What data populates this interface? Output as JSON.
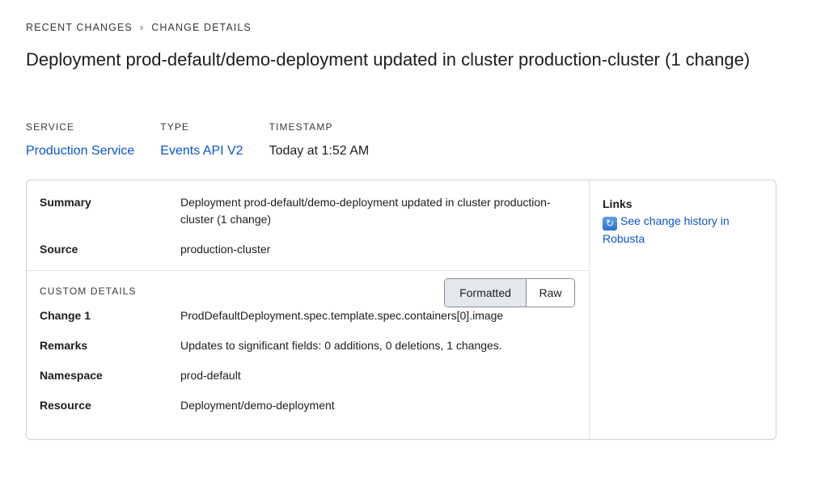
{
  "breadcrumb": {
    "parent": "RECENT CHANGES",
    "separator": "›",
    "current": "CHANGE DETAILS"
  },
  "title": "Deployment prod-default/demo-deployment updated in cluster production-cluster (1 change)",
  "meta": {
    "service": {
      "label": "SERVICE",
      "value": "Production Service"
    },
    "type": {
      "label": "TYPE",
      "value": "Events API V2"
    },
    "timestamp": {
      "label": "TIMESTAMP",
      "value": "Today at 1:52 AM"
    }
  },
  "details": {
    "summary": {
      "label": "Summary",
      "value": "Deployment prod-default/demo-deployment updated in cluster production-cluster (1 change)"
    },
    "source": {
      "label": "Source",
      "value": "production-cluster"
    }
  },
  "custom": {
    "title": "CUSTOM DETAILS",
    "toggle": {
      "formatted": "Formatted",
      "raw": "Raw",
      "selected": "Formatted"
    },
    "fields": [
      {
        "label": "Change 1",
        "value": "ProdDefaultDeployment.spec.template.spec.containers[0].image"
      },
      {
        "label": "Remarks",
        "value": "Updates to significant fields: 0 additions, 0 deletions, 1 changes."
      },
      {
        "label": "Namespace",
        "value": "prod-default"
      },
      {
        "label": "Resource",
        "value": "Deployment/demo-deployment"
      }
    ]
  },
  "links": {
    "title": "Links",
    "items": [
      {
        "label": "See change history in Robusta",
        "icon": "refresh-icon"
      }
    ]
  },
  "colors": {
    "link": "#0a55c7",
    "toggle_active": "#e3e8ef",
    "border": "#d2d2d7"
  }
}
